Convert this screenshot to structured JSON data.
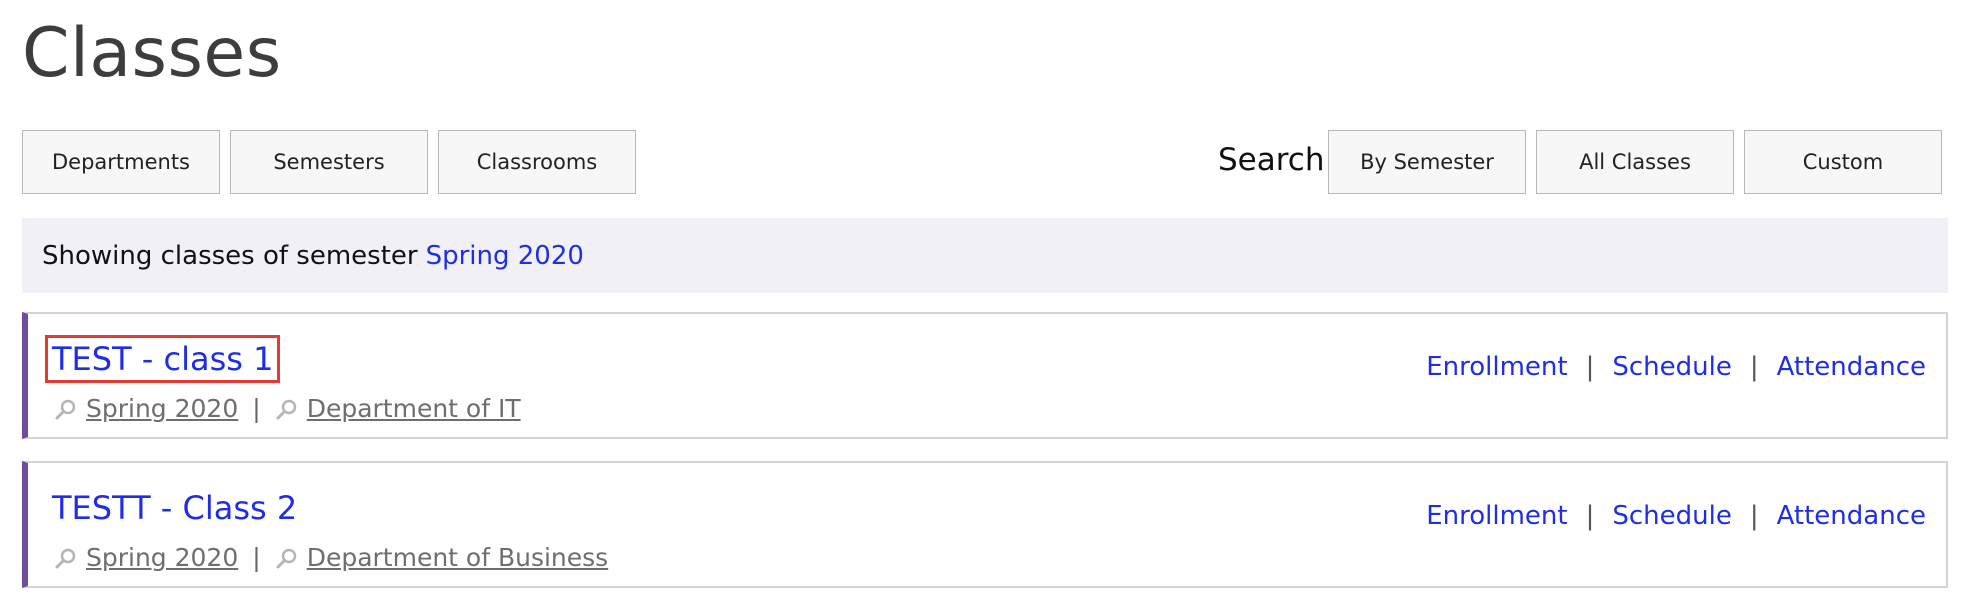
{
  "page": {
    "title": "Classes"
  },
  "toolbar": {
    "left_buttons": [
      "Departments",
      "Semesters",
      "Classrooms"
    ],
    "search_label": "Search:",
    "right_buttons": [
      "By Semester",
      "All Classes",
      "Custom"
    ]
  },
  "banner": {
    "prefix": "Showing classes of semester",
    "semester_link": "Spring 2020"
  },
  "classes": [
    {
      "title": "TEST - class 1",
      "semester": "Spring 2020",
      "department": "Department of IT",
      "highlighted": true
    },
    {
      "title": "TESTT - Class 2",
      "semester": "Spring 2020",
      "department": "Department of Business",
      "highlighted": false
    }
  ],
  "actions": {
    "enrollment": "Enrollment",
    "schedule": "Schedule",
    "attendance": "Attendance",
    "separator": "|"
  },
  "colors": {
    "link": "#1f2ee6",
    "accent_bar": "#6f4d9c",
    "banner_bg": "#f2f0f7",
    "highlight": "#e53935"
  },
  "icons": {
    "meta_search": "magnifier-icon"
  }
}
